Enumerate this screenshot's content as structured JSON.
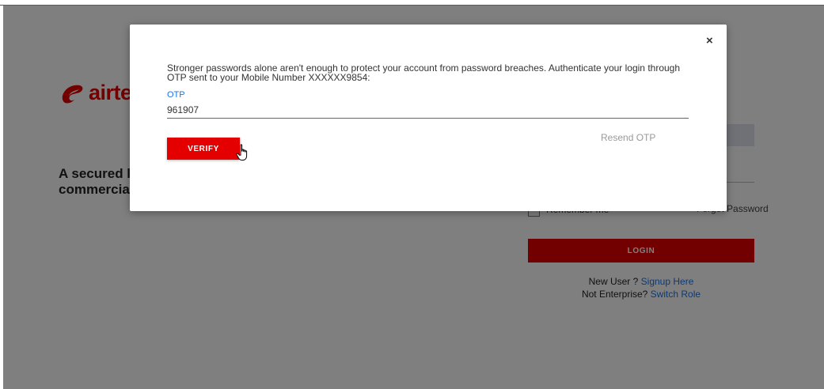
{
  "brand": {
    "name": "airtel",
    "color": "#e40000"
  },
  "tagline": {
    "line1": "A secured l",
    "line2": "commercia"
  },
  "login_form": {
    "remember_label": "Remember me",
    "forgot_label": "Forgot Password",
    "login_button": "LOGIN",
    "new_user_text": "New User ? ",
    "signup_link": "Signup Here",
    "not_enterprise_text": "Not Enterprise? ",
    "switch_role_link": "Switch Role"
  },
  "modal": {
    "close_label": "×",
    "message": "Stronger passwords alone aren't enough to protect your account from password breaches. Authenticate your login through OTP sent to your Mobile Number XXXXXX9854:",
    "otp_label": "OTP",
    "otp_value": "961907",
    "verify_button": "VERIFY",
    "resend_link": "Resend OTP"
  },
  "colors": {
    "accent": "#e40000",
    "link": "#1a73e8"
  }
}
